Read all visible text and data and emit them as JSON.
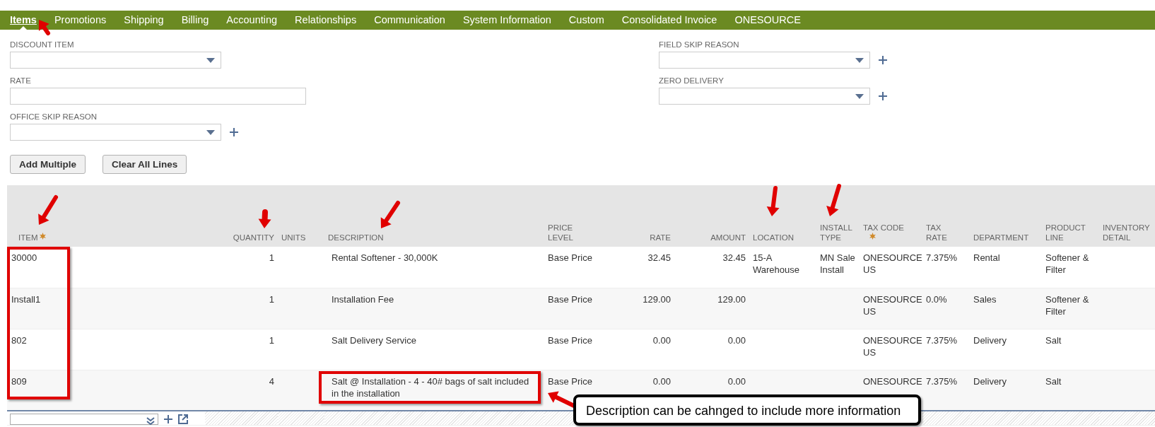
{
  "tabs": [
    {
      "label": "Items",
      "selected": true
    },
    {
      "label": "Promotions",
      "selected": false
    },
    {
      "label": "Shipping",
      "selected": false
    },
    {
      "label": "Billing",
      "selected": false
    },
    {
      "label": "Accounting",
      "selected": false
    },
    {
      "label": "Relationships",
      "selected": false
    },
    {
      "label": "Communication",
      "selected": false
    },
    {
      "label": "System Information",
      "selected": false
    },
    {
      "label": "Custom",
      "selected": false
    },
    {
      "label": "Consolidated Invoice",
      "selected": false
    },
    {
      "label": "ONESOURCE",
      "selected": false
    }
  ],
  "fields_left": [
    {
      "label": "DISCOUNT ITEM",
      "kind": "select",
      "add": false
    },
    {
      "label": "RATE",
      "kind": "text",
      "add": false
    },
    {
      "label": "OFFICE SKIP REASON",
      "kind": "select",
      "add": true
    }
  ],
  "fields_right": [
    {
      "label": "FIELD SKIP REASON",
      "kind": "select",
      "add": true
    },
    {
      "label": "ZERO DELIVERY",
      "kind": "select",
      "add": true
    }
  ],
  "buttons": [
    "Add Multiple",
    "Clear All Lines"
  ],
  "table": {
    "columns": [
      {
        "label": "ITEM",
        "required": true,
        "numeric": false
      },
      {
        "label": "QUANTITY",
        "required": false,
        "numeric": true
      },
      {
        "label": "UNITS",
        "required": false,
        "numeric": false
      },
      {
        "label": "DESCRIPTION",
        "required": false,
        "numeric": false
      },
      {
        "label": "PRICE LEVEL",
        "required": false,
        "numeric": false
      },
      {
        "label": "RATE",
        "required": false,
        "numeric": true
      },
      {
        "label": "AMOUNT",
        "required": false,
        "numeric": true
      },
      {
        "label": "LOCATION",
        "required": false,
        "numeric": false
      },
      {
        "label": "INSTALL TYPE",
        "required": false,
        "numeric": false
      },
      {
        "label": "TAX CODE",
        "required": true,
        "numeric": false
      },
      {
        "label": "TAX RATE",
        "required": false,
        "numeric": false
      },
      {
        "label": "DEPARTMENT",
        "required": false,
        "numeric": false
      },
      {
        "label": "PRODUCT LINE",
        "required": false,
        "numeric": false
      },
      {
        "label": "INVENTORY DETAIL",
        "required": false,
        "numeric": false
      }
    ],
    "rows": [
      [
        "30000",
        "1",
        "",
        "Rental Softener - 30,000K",
        "Base Price",
        "32.45",
        "32.45",
        "15-A Warehouse",
        "MN Sale Install",
        "ONESOURCE US",
        "7.375%",
        "Rental",
        "Softener & Filter",
        ""
      ],
      [
        "Install1",
        "1",
        "",
        "Installation Fee",
        "Base Price",
        "129.00",
        "129.00",
        "",
        "",
        "ONESOURCE US",
        "0.0%",
        "Sales",
        "Softener & Filter",
        ""
      ],
      [
        "802",
        "1",
        "",
        "Salt Delivery Service",
        "Base Price",
        "0.00",
        "0.00",
        "",
        "",
        "ONESOURCE US",
        "7.375%",
        "Delivery",
        "Salt",
        ""
      ],
      [
        "809",
        "4",
        "",
        "Salt @ Installation - 4 - 40# bags of salt included in the installation",
        "Base Price",
        "0.00",
        "0.00",
        "",
        "",
        "ONESOURCE",
        "7.375%",
        "Delivery",
        "Salt",
        ""
      ]
    ]
  },
  "annotations": {
    "callout": "Description can be cahnged to include more information"
  }
}
